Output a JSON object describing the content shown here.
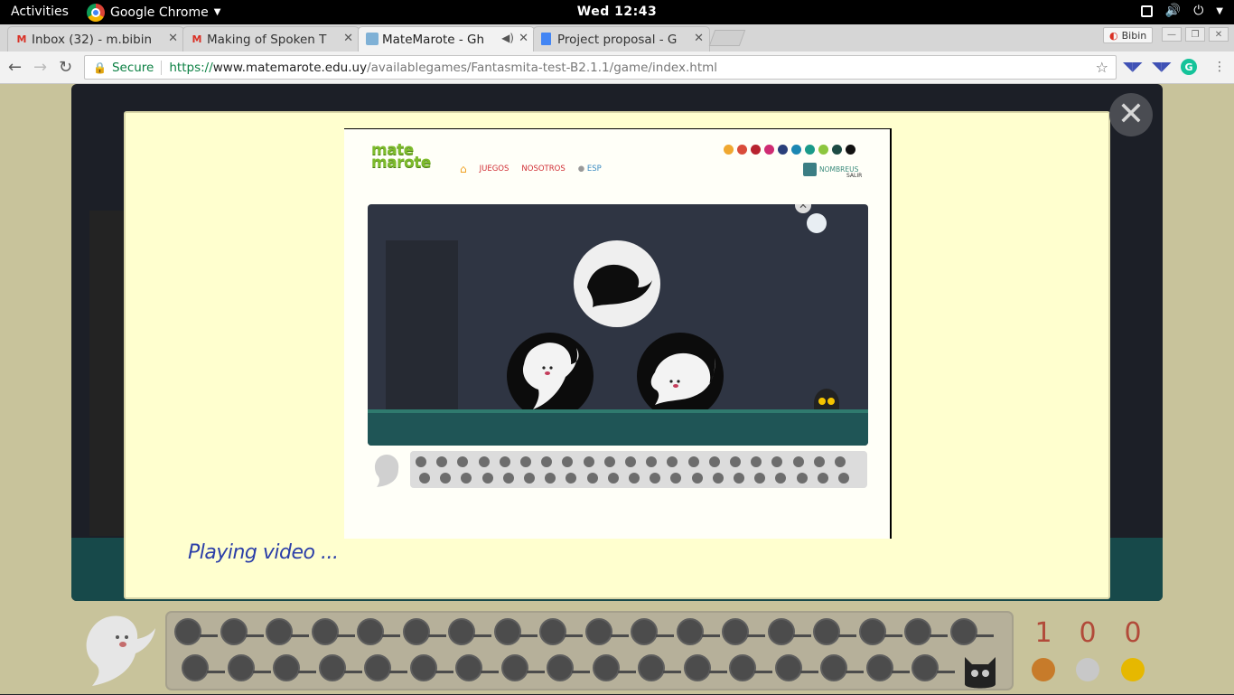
{
  "topbar": {
    "activities": "Activities",
    "app_name": "Google Chrome",
    "clock": "Wed 12:43"
  },
  "tabs": [
    {
      "label": "Inbox (32) - m.bibin",
      "favicon": "gmail-icon"
    },
    {
      "label": "Making of Spoken T",
      "favicon": "gmail-icon"
    },
    {
      "label": "MateMarote - Gh",
      "favicon": "matemarote-icon",
      "active": true
    },
    {
      "label": "Project proposal - G",
      "favicon": "docs-icon"
    }
  ],
  "window": {
    "profile_label": "Bibin"
  },
  "omnibox": {
    "secure_label": "Secure",
    "url_scheme": "https://",
    "url_host": "www.matemarote.edu.uy",
    "url_path": "/availablegames/Fantasmita-test-B2.1.1/game/index.html"
  },
  "video": {
    "logo_text_1": "mate",
    "logo_text_2": "marote",
    "nav": {
      "juegos": "JUEGOS",
      "nosotros": "NOSOTROS",
      "lang": "ESP"
    },
    "user": "NOMBREUS",
    "salir": "SALIR",
    "dot_colors": [
      "#f0a830",
      "#d94c3a",
      "#b8232f",
      "#cf2c73",
      "#2a3f7a",
      "#1c87b3",
      "#1a9a8a",
      "#8cc63e",
      "#1d4b44",
      "#111111"
    ]
  },
  "modal": {
    "status_text": "Playing video ..."
  },
  "scores": {
    "values": [
      "1",
      "0",
      "0"
    ],
    "medal_colors": [
      "#c77b2a",
      "#c8c8c8",
      "#e6b800"
    ]
  },
  "colors": {
    "page_bg": "#c8c39b",
    "modal_bg": "#ffffcf",
    "status_text": "#2c3fa8",
    "score_text": "#b24a39"
  }
}
